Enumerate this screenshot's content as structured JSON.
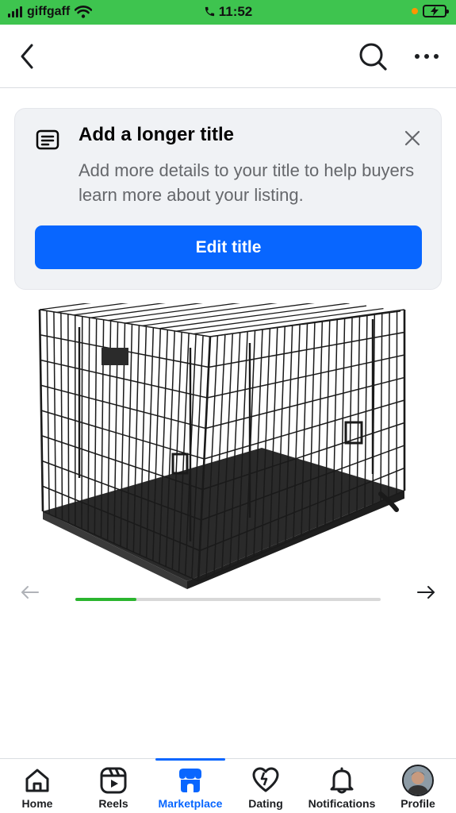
{
  "status_bar": {
    "carrier": "giffgaff",
    "time": "11:52"
  },
  "icons": {
    "back": "chevron-left-icon",
    "search": "search-icon",
    "more": "more-horizontal-icon",
    "document": "document-icon",
    "close": "close-icon"
  },
  "prompt": {
    "title": "Add a longer title",
    "description": "Add more details to your title to help buyers learn more about your listing.",
    "button_label": "Edit title"
  },
  "carousel": {
    "progress": 0.2
  },
  "tabs": [
    {
      "label": "Home",
      "icon": "home-icon",
      "active": false
    },
    {
      "label": "Reels",
      "icon": "reels-icon",
      "active": false
    },
    {
      "label": "Marketplace",
      "icon": "marketplace-icon",
      "active": true
    },
    {
      "label": "Dating",
      "icon": "dating-icon",
      "active": false
    },
    {
      "label": "Notifications",
      "icon": "bell-icon",
      "active": false
    },
    {
      "label": "Profile",
      "icon": "avatar",
      "active": false
    }
  ],
  "colors": {
    "status_bar": "#3ec44f",
    "accent": "#0866ff",
    "progress": "#2bb52f"
  }
}
